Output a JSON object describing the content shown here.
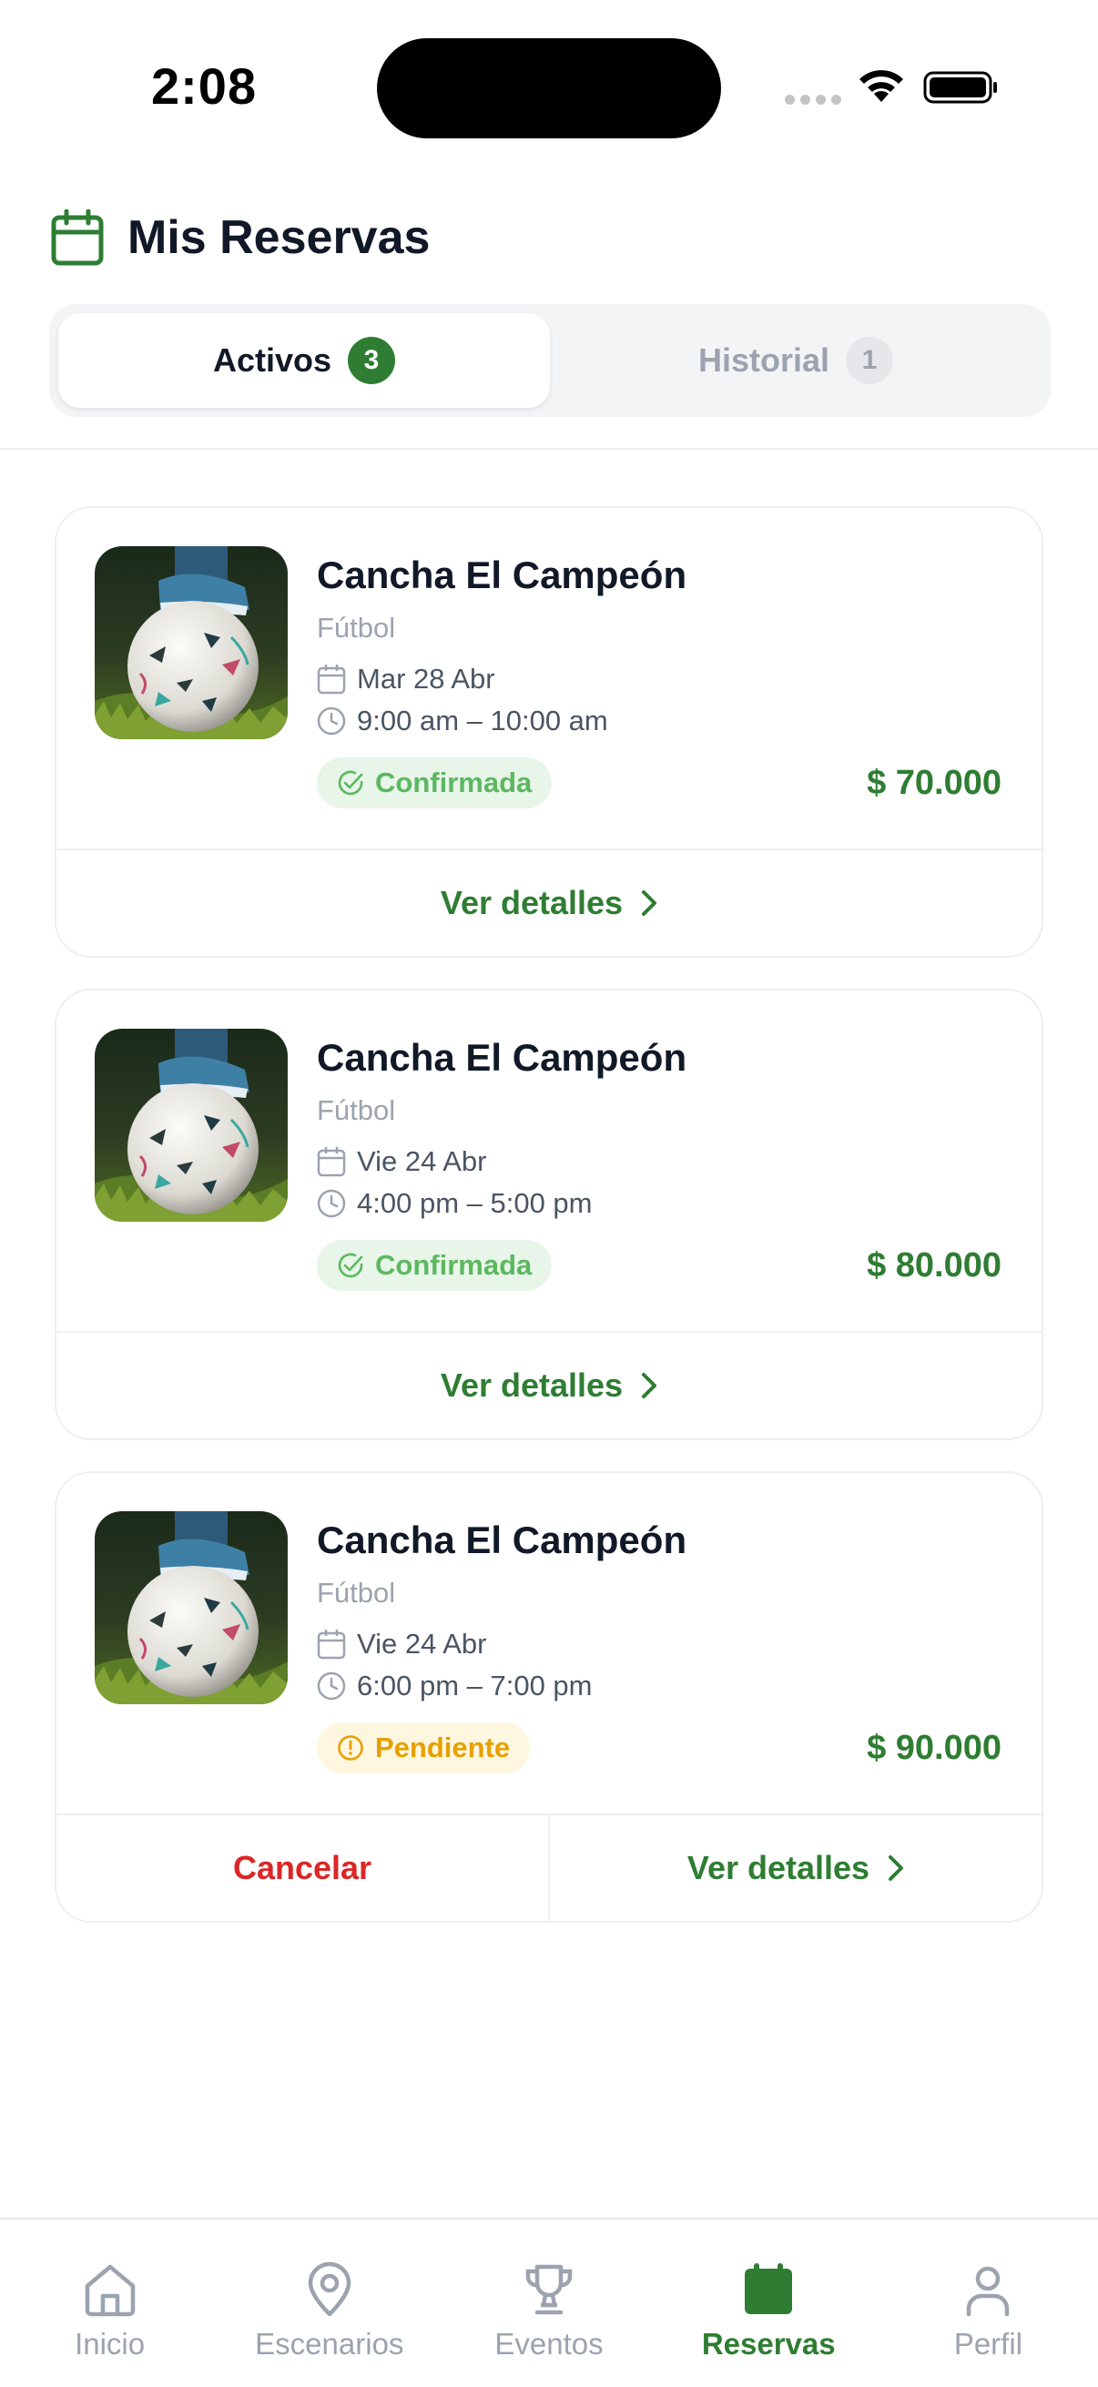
{
  "status_bar": {
    "time": "2:08"
  },
  "header": {
    "title": "Mis Reservas",
    "icon": "calendar-icon"
  },
  "tabs": [
    {
      "label": "Activos",
      "count": "3",
      "active": true
    },
    {
      "label": "Historial",
      "count": "1",
      "active": false
    }
  ],
  "reservations": [
    {
      "venue": "Cancha El Campeón",
      "sport": "Fútbol",
      "date": "Mar 28 Abr",
      "time": "9:00 am – 10:00 am",
      "status": "Confirmada",
      "price": "$ 70.000",
      "details_label": "Ver detalles"
    },
    {
      "venue": "Cancha El Campeón",
      "sport": "Fútbol",
      "date": "Vie 24 Abr",
      "time": "4:00 pm – 5:00 pm",
      "status": "Confirmada",
      "price": "$ 80.000",
      "details_label": "Ver detalles"
    },
    {
      "venue": "Cancha El Campeón",
      "sport": "Fútbol",
      "date": "Vie 24 Abr",
      "time": "6:00 pm – 7:00 pm",
      "status": "Pendiente",
      "price": "$ 90.000",
      "cancel_label": "Cancelar",
      "details_label": "Ver detalles"
    }
  ],
  "nav": [
    {
      "label": "Inicio",
      "icon": "home-icon"
    },
    {
      "label": "Escenarios",
      "icon": "map-pin-icon"
    },
    {
      "label": "Eventos",
      "icon": "trophy-icon"
    },
    {
      "label": "Reservas",
      "icon": "calendar-icon",
      "active": true
    },
    {
      "label": "Perfil",
      "icon": "user-icon"
    }
  ],
  "colors": {
    "primary": "#2e7d32",
    "confirmed": "#5cb85f",
    "pending": "#e6a000",
    "danger": "#dc2626"
  }
}
